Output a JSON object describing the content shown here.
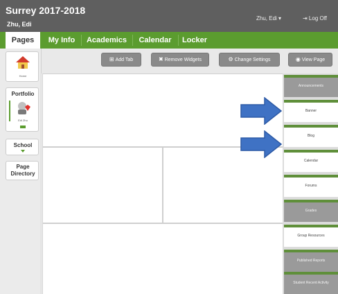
{
  "header": {
    "title": "Surrey 2017-2018",
    "user_short": "Zhu, Edi",
    "user_menu": "Zhu, Edi ▾",
    "logoff": "⇥ Log Off"
  },
  "nav": {
    "tabs": [
      "Pages",
      "My Info",
      "Academics",
      "Calendar",
      "Locker"
    ],
    "active": "Pages"
  },
  "toolbar": {
    "buttons": [
      {
        "label": "Add Tab",
        "icon": "⊞"
      },
      {
        "label": "Remove Widgets",
        "icon": "✖"
      },
      {
        "label": "Change Settings",
        "icon": "⚙"
      },
      {
        "label": "View Page",
        "icon": "◉"
      }
    ]
  },
  "left": {
    "home_label": "Home",
    "portfolio_title": "Portfolio",
    "portfolio_user": "Edi Zhu",
    "school_title": "School",
    "page_directory_title": "Page Directory"
  },
  "widgets": [
    {
      "label": "Announcements",
      "style": "dark"
    },
    {
      "label": "Banner",
      "style": "light"
    },
    {
      "label": "Blog",
      "style": "light"
    },
    {
      "label": "Calendar",
      "style": "light"
    },
    {
      "label": "Forums",
      "style": "light"
    },
    {
      "label": "Grades",
      "style": "dark"
    },
    {
      "label": "Group Resources",
      "style": "light"
    },
    {
      "label": "Published Reports",
      "style": "dark"
    },
    {
      "label": "Student Recent Activity",
      "style": "dark"
    }
  ],
  "colors": {
    "nav_green": "#5b9c2f",
    "header_gray": "#5f5f5f",
    "arrow_blue": "#3f72c4"
  }
}
